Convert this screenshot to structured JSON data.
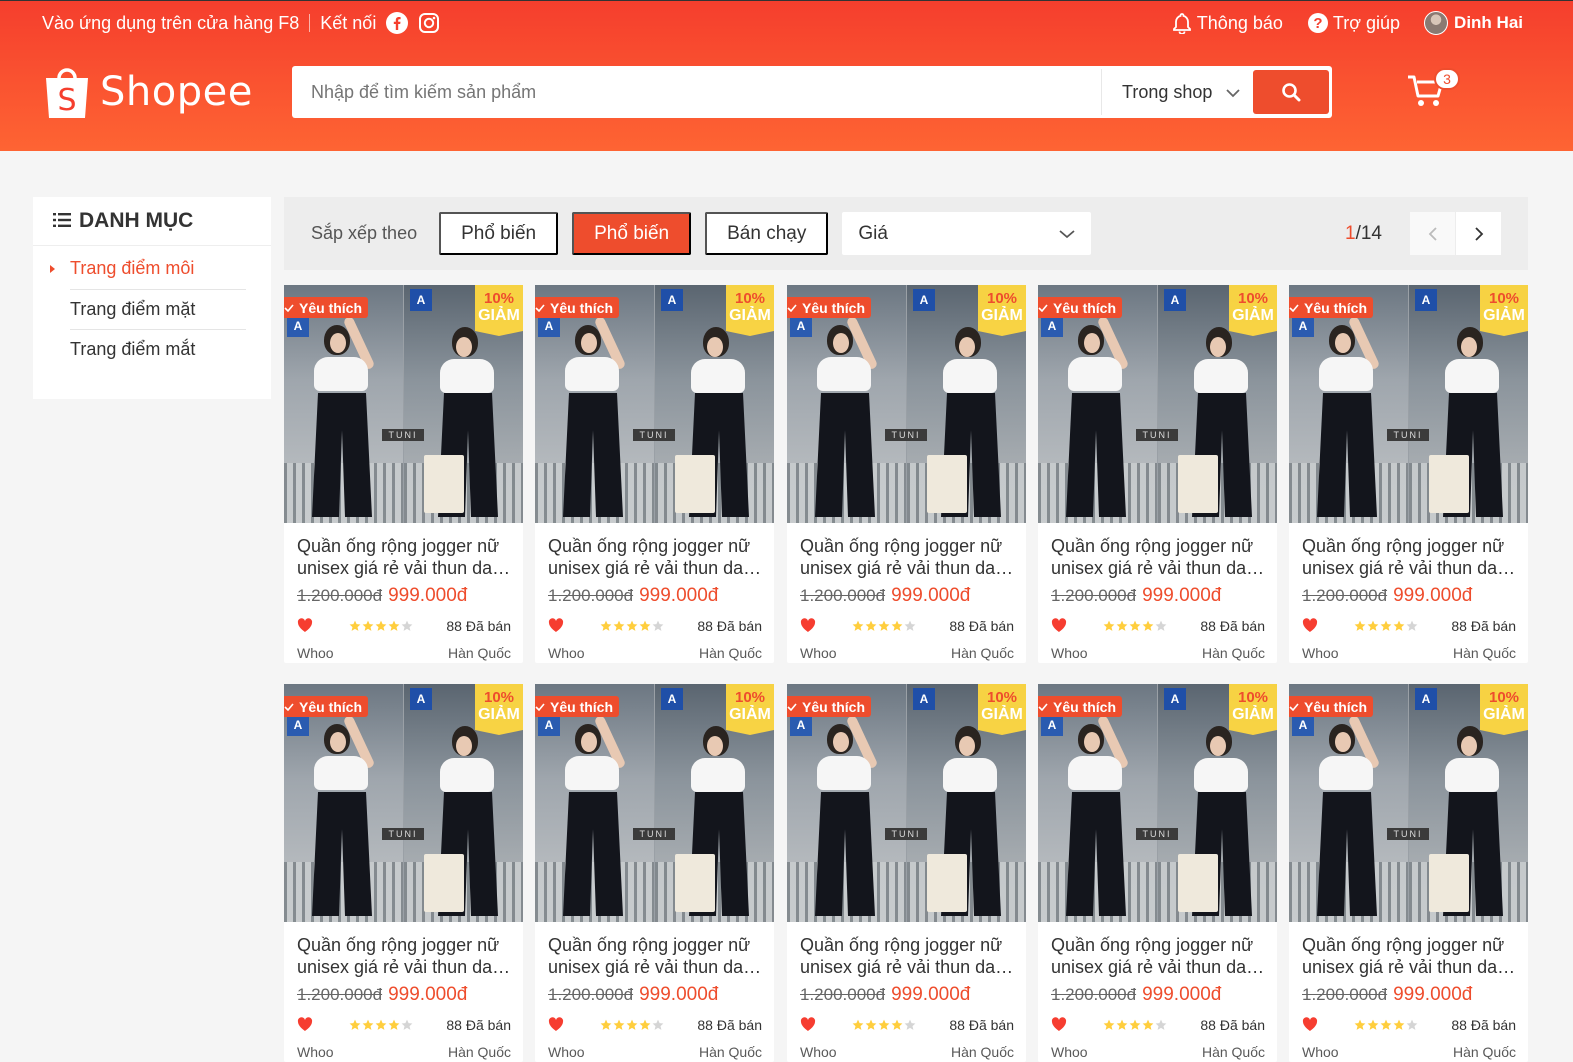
{
  "navbar": {
    "app_download": "Vào ứng dụng trên cửa hàng F8",
    "connect": "Kết nối",
    "notifications": "Thông báo",
    "help": "Trợ giúp",
    "user_name": "Dinh Hai"
  },
  "header": {
    "logo_text": "Shopee",
    "search_placeholder": "Nhập để tìm kiếm sản phẩm",
    "search_scope": "Trong shop",
    "cart_count": "3"
  },
  "category": {
    "heading": "DANH MỤC",
    "items": [
      {
        "label": "Trang điểm môi",
        "active": true
      },
      {
        "label": "Trang điểm mặt",
        "active": false
      },
      {
        "label": "Trang điểm mắt",
        "active": false
      }
    ]
  },
  "filter": {
    "label": "Sắp xếp theo",
    "buttons": [
      "Phổ biến",
      "Phổ biến",
      "Bán chạy"
    ],
    "price_select": "Giá",
    "page_current": "1",
    "page_total": "/14"
  },
  "product": {
    "favourite": "Yêu thích",
    "sale_percent": "10%",
    "sale_label": "GIẢM",
    "name_line1": "Quần ống rộng jogger nữ",
    "name_line2": "unisex giá rẻ vải thun da c...",
    "price_old": "1.200.000đ",
    "price_current": "999.000đ",
    "rating": 4,
    "sold": "88 Đã bán",
    "brand": "Whoo",
    "origin": "Hàn Quốc"
  },
  "products_count": 10,
  "colors": {
    "primary": "#ee4d2d",
    "header_gradient_top": "#f53e2d",
    "header_gradient_bottom": "#fe6433",
    "sale_badge": "#ffd840",
    "star": "#ffce3d"
  }
}
